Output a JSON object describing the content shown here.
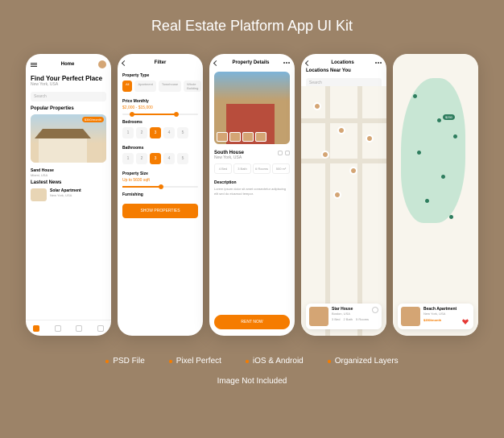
{
  "title": "Real Estate Platform App UI Kit",
  "features": [
    "PSD File",
    "Pixel Perfect",
    "iOS & Android",
    "Organized Layers"
  ],
  "footer": "Image Not Included",
  "s1": {
    "header": "Home",
    "headline": "Find Your Perfect Place",
    "location": "New York, USA",
    "search": "Search",
    "section1": "Popular Properties",
    "badge": "$350/month",
    "card_title": "Sand House",
    "card_sub": "Miami, USA",
    "section2": "Lastest News",
    "news_title": "Solar Apartment",
    "news_sub": "New York, USA"
  },
  "s2": {
    "header": "Filter",
    "l1": "Property Type",
    "chips": [
      "All",
      "Apartment",
      "Townhouse",
      "Whole Building"
    ],
    "l2": "Price Monthly",
    "range": "$2,000 - $15,000",
    "l3": "Bedrooms",
    "l4": "Bathrooms",
    "l5": "Property Size",
    "size": "Up to 5600 sqft",
    "l6": "Furnishing",
    "btn": "SHOW PROPERTIES"
  },
  "s3": {
    "header": "Property Details",
    "title": "South House",
    "sub": "New York, USA",
    "specs": [
      "4 Bed",
      "3 Bath",
      "6 Rooms",
      "500 m²"
    ],
    "desc_label": "Description",
    "desc": "Lorem ipsum dolor sit amet consectetur adipiscing elit sed do eiusmod tempor.",
    "btn": "RENT NOW"
  },
  "s4": {
    "header": "Locations",
    "sub": "Locations Near You",
    "search": "Search",
    "card_title": "Star House",
    "card_sub": "Boston, USA",
    "specs": [
      "3 Bed",
      "2 Bath",
      "5 Rooms"
    ]
  },
  "s5": {
    "price": "$250",
    "card_title": "Beach Apartment",
    "card_sub": "New York, USA",
    "badge": "$350/month"
  }
}
